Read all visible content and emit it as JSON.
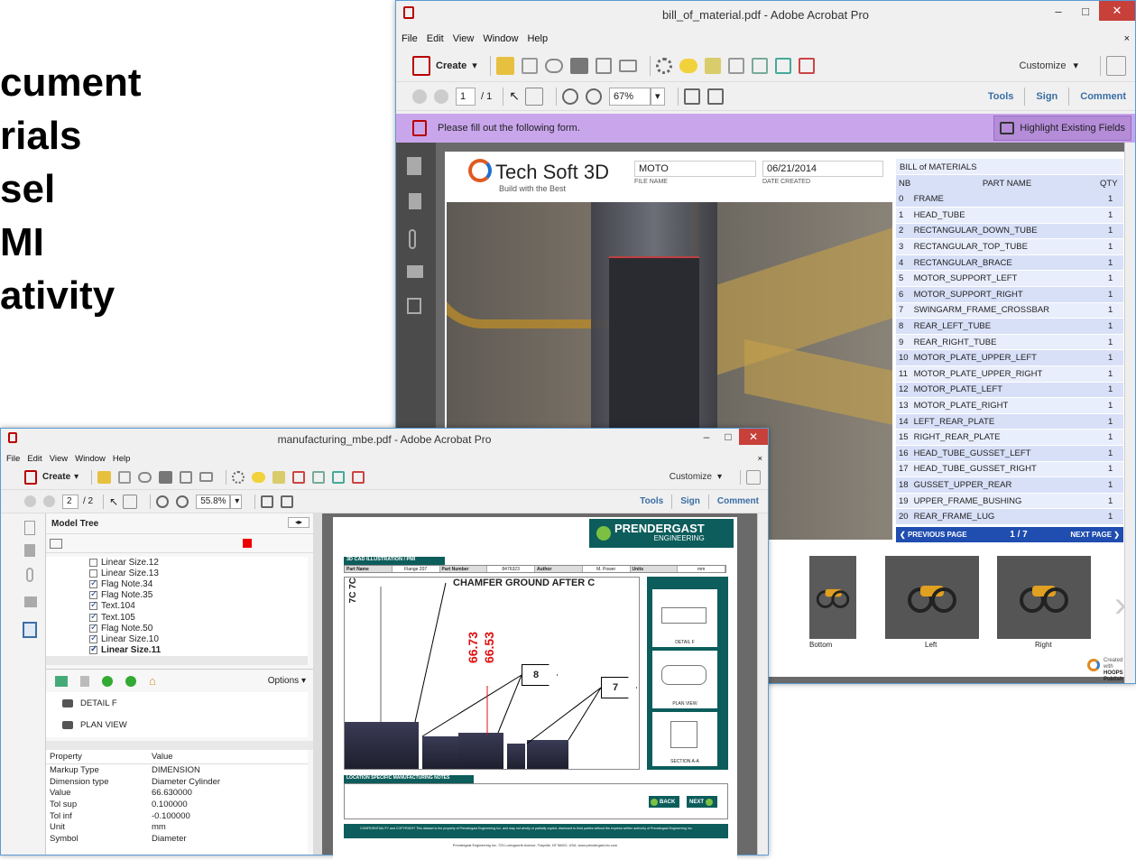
{
  "slide": {
    "lines": [
      "cument",
      "rials",
      "sel",
      "MI",
      "ativity"
    ]
  },
  "back_window": {
    "title": "bill_of_material.pdf - Adobe Acrobat Pro",
    "menu": [
      "File",
      "Edit",
      "View",
      "Window",
      "Help"
    ],
    "toolbar": {
      "create_label": "Create",
      "customize_label": "Customize"
    },
    "nav": {
      "page": "1",
      "page_total": "/ 1",
      "zoom": "67%",
      "tools": "Tools",
      "sign": "Sign",
      "comment": "Comment"
    },
    "form_bar": {
      "message": "Please fill out the following form.",
      "highlight_label": "Highlight Existing Fields"
    },
    "doc": {
      "logo": "Tech Soft 3D",
      "tagline": "Build with the Best",
      "file_name_value": "MOTO",
      "file_name_label": "FILE NAME",
      "date_value": "06/21/2014",
      "date_label": "DATE CREATED",
      "bom_title": "BILL of MATERIALS",
      "bom_headers": [
        "NB",
        "PART NAME",
        "QTY"
      ],
      "bom_rows": [
        [
          "0",
          "FRAME",
          "1"
        ],
        [
          "1",
          "HEAD_TUBE",
          "1"
        ],
        [
          "2",
          "RECTANGULAR_DOWN_TUBE",
          "1"
        ],
        [
          "3",
          "RECTANGULAR_TOP_TUBE",
          "1"
        ],
        [
          "4",
          "RECTANGULAR_BRACE",
          "1"
        ],
        [
          "5",
          "MOTOR_SUPPORT_LEFT",
          "1"
        ],
        [
          "6",
          "MOTOR_SUPPORT_RIGHT",
          "1"
        ],
        [
          "7",
          "SWINGARM_FRAME_CROSSBAR",
          "1"
        ],
        [
          "8",
          "REAR_LEFT_TUBE",
          "1"
        ],
        [
          "9",
          "REAR_RIGHT_TUBE",
          "1"
        ],
        [
          "10",
          "MOTOR_PLATE_UPPER_LEFT",
          "1"
        ],
        [
          "11",
          "MOTOR_PLATE_UPPER_RIGHT",
          "1"
        ],
        [
          "12",
          "MOTOR_PLATE_LEFT",
          "1"
        ],
        [
          "13",
          "MOTOR_PLATE_RIGHT",
          "1"
        ],
        [
          "14",
          "LEFT_REAR_PLATE",
          "1"
        ],
        [
          "15",
          "RIGHT_REAR_PLATE",
          "1"
        ],
        [
          "16",
          "HEAD_TUBE_GUSSET_LEFT",
          "1"
        ],
        [
          "17",
          "HEAD_TUBE_GUSSET_RIGHT",
          "1"
        ],
        [
          "18",
          "GUSSET_UPPER_REAR",
          "1"
        ],
        [
          "19",
          "UPPER_FRAME_BUSHING",
          "1"
        ],
        [
          "20",
          "REAR_FRAME_LUG",
          "1"
        ]
      ],
      "prev_page": "PREVIOUS PAGE",
      "page_indicator": "1 / 7",
      "next_page": "NEXT PAGE",
      "views": [
        "Bottom",
        "Left",
        "Right"
      ],
      "created_with": "Created with",
      "hoops": "HOOPS Publish"
    }
  },
  "front_window": {
    "title": "manufacturing_mbe.pdf - Adobe Acrobat Pro",
    "menu": [
      "File",
      "Edit",
      "View",
      "Window",
      "Help"
    ],
    "toolbar": {
      "create_label": "Create",
      "customize_label": "Customize"
    },
    "nav": {
      "page": "2",
      "page_total": "/ 2",
      "zoom": "55.8%",
      "tools": "Tools",
      "sign": "Sign",
      "comment": "Comment"
    },
    "model_tree": {
      "title": "Model Tree",
      "items": [
        {
          "label": "Linear Size.12",
          "checked": false
        },
        {
          "label": "Linear Size.13",
          "checked": false
        },
        {
          "label": "Flag Note.34",
          "checked": true
        },
        {
          "label": "Flag Note.35",
          "checked": true
        },
        {
          "label": "Text.104",
          "checked": true
        },
        {
          "label": "Text.105",
          "checked": true
        },
        {
          "label": "Flag Note.50",
          "checked": true
        },
        {
          "label": "Linear Size.10",
          "checked": true
        },
        {
          "label": "Linear Size.11",
          "checked": true
        }
      ],
      "options_label": "Options",
      "views": [
        "DETAIL F",
        "PLAN VIEW"
      ],
      "property_header": [
        "Property",
        "Value"
      ],
      "properties": [
        [
          "Markup Type",
          "DIMENSION"
        ],
        [
          "Dimension type",
          "Diameter Cylinder"
        ],
        [
          "Value",
          "66.630000"
        ],
        [
          "Tol sup",
          "0.100000"
        ],
        [
          "Tol inf",
          "-0.100000"
        ],
        [
          "Unit",
          "mm"
        ],
        [
          "Symbol",
          "Diameter"
        ]
      ]
    },
    "doc": {
      "brand": "PRENDERGAST",
      "brand_sub": "ENGINEERING",
      "section_title": "3D CAD ILLUSTRATION / PMI",
      "meta": [
        "Part Name",
        "Flange 207",
        "Part Number",
        "8476323",
        "Author",
        "M. Power",
        "Units",
        "mm"
      ],
      "annotation": "CHAMFER GROUND AFTER C",
      "dim1": "66.73",
      "dim2": "66.53",
      "flag8": "8",
      "flag7": "7",
      "side_views": [
        "DETAIL F",
        "PLAN VIEW",
        "SECTION A-A"
      ],
      "notes_title": "LOCATION SPECIFIC MANUFACTURING NOTES",
      "back_label": "BACK",
      "next_label": "NEXT",
      "footer_copyright": "CONFIDENTIALITY and COPYRIGHT  This dataset is the property of Prendergast Engineering Inc. and may not wholly or partially copied, disclosed to third parties without the express written authority of Prendergast Engineering Inc.",
      "footer_address": "Prendergast Engineering Inc. 723 Lovingworth Avenue, Frayville, NT 56002, USA. www.prendergast-inc.com"
    }
  },
  "colors": {
    "accent": "#3a6ea5",
    "form_bar": "#c9a6ec",
    "red_close": "#c7403a",
    "bom_blue": "#1f4db0",
    "prendergast_teal": "#0c5d5b"
  }
}
